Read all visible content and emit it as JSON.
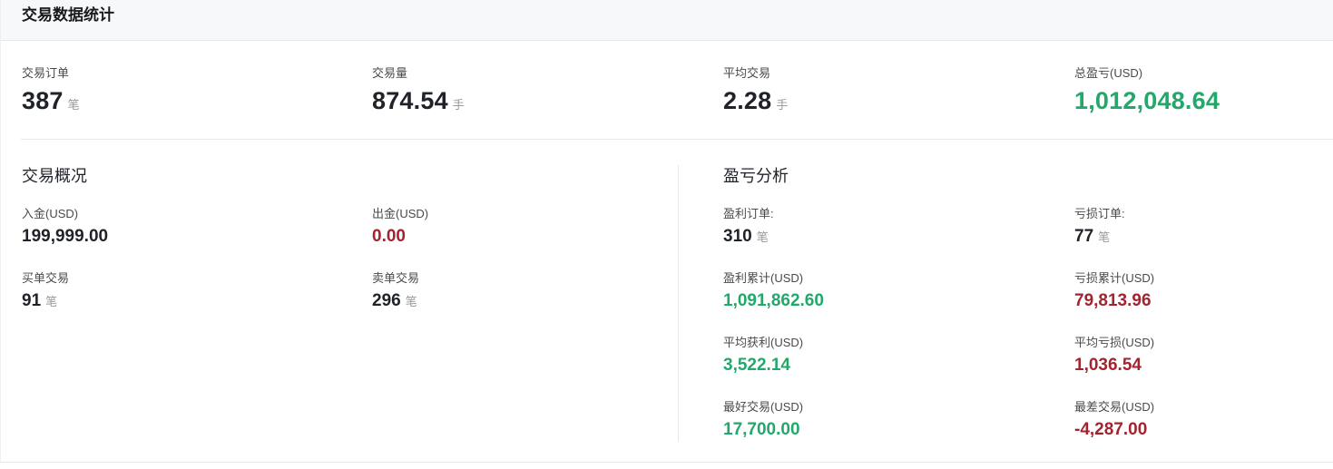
{
  "header": {
    "title": "交易数据统计"
  },
  "summary": {
    "orders": {
      "label": "交易订单",
      "value": "387",
      "unit": "笔"
    },
    "volume": {
      "label": "交易量",
      "value": "874.54",
      "unit": "手"
    },
    "average": {
      "label": "平均交易",
      "value": "2.28",
      "unit": "手"
    },
    "total_pnl": {
      "label": "总盈亏(USD)",
      "value": "1,012,048.64"
    }
  },
  "overview": {
    "title": "交易概况",
    "deposit": {
      "label": "入金(USD)",
      "value": "199,999.00"
    },
    "withdraw": {
      "label": "出金(USD)",
      "value": "0.00"
    },
    "buy_trades": {
      "label": "买单交易",
      "value": "91",
      "unit": "笔"
    },
    "sell_trades": {
      "label": "卖单交易",
      "value": "296",
      "unit": "笔"
    }
  },
  "pnl_analysis": {
    "title": "盈亏分析",
    "profit_orders": {
      "label": "盈利订单:",
      "value": "310",
      "unit": "笔"
    },
    "loss_orders": {
      "label": "亏损订单:",
      "value": "77",
      "unit": "笔"
    },
    "profit_total": {
      "label": "盈利累计(USD)",
      "value": "1,091,862.60"
    },
    "loss_total": {
      "label": "亏损累计(USD)",
      "value": "79,813.96"
    },
    "avg_profit": {
      "label": "平均获利(USD)",
      "value": "3,522.14"
    },
    "avg_loss": {
      "label": "平均亏损(USD)",
      "value": "1,036.54"
    },
    "best_trade": {
      "label": "最好交易(USD)",
      "value": "17,700.00"
    },
    "worst_trade": {
      "label": "最差交易(USD)",
      "value": "-4,287.00"
    }
  },
  "colors": {
    "positive": "#22a86b",
    "negative": "#a3232f",
    "header_bg": "#f7f8fa"
  }
}
